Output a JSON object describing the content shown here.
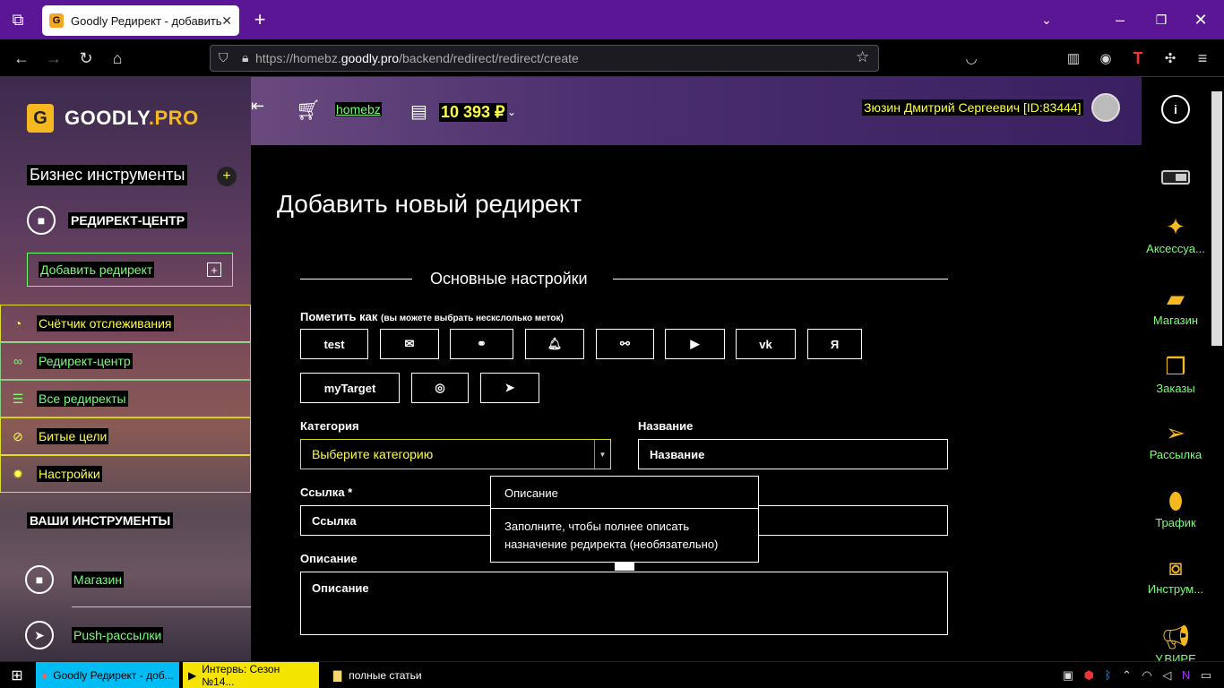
{
  "browser": {
    "tab_title": "Goodly Редирект - добавить",
    "url_prefix": "https://homebz.",
    "url_domain": "goodly.pro",
    "url_path": "/backend/redirect/redirect/create"
  },
  "sidebar": {
    "logo_text_main": "GOODLY",
    "logo_text_suffix": ".PRO",
    "logo_letter": "G",
    "section_title": "Бизнес инструменты",
    "active_tool": "РЕДИРЕКТ-ЦЕНТР",
    "add_button": "Добавить редирект",
    "menu": [
      {
        "label": "Счётчик отслеживания",
        "color": "#ffff44",
        "icon": "gauge-icon",
        "glyph": "◔"
      },
      {
        "label": "Редирект-центр",
        "color": "#77ff77",
        "icon": "link-icon",
        "glyph": "∞"
      },
      {
        "label": "Все редиректы",
        "color": "#77ff77",
        "icon": "list-icon",
        "glyph": "☰"
      },
      {
        "label": "Битые цели",
        "color": "#ffff44",
        "icon": "ban-icon",
        "glyph": "⊘"
      },
      {
        "label": "Настройки",
        "color": "#ffff44",
        "icon": "gear-icon",
        "glyph": "✹"
      }
    ],
    "tools_title": "ВАШИ ИНСТРУМЕНТЫ",
    "tools": [
      {
        "label": "Магазин"
      },
      {
        "label": "Push-рассылки"
      }
    ]
  },
  "header": {
    "shop_link": "homebz",
    "balance": "10 393 ₽",
    "user": "Зюзин Дмитрий Сергеевич [ID:83444]"
  },
  "page": {
    "title": "Добавить новый редирект",
    "section": "Основные настройки",
    "mark_label": "Пометить как",
    "mark_hint": "(вы можете выбрать нескслолько меток)",
    "marks_row1": [
      "test",
      "",
      "",
      "",
      "",
      "",
      "",
      "Я"
    ],
    "marks_row2": [
      "myTarget",
      "",
      ""
    ],
    "category_label": "Категория",
    "category_value": "Выберите категорию",
    "name_label": "Название",
    "name_placeholder": "Название",
    "link_label": "Ссылка *",
    "link_placeholder": "Ссылка",
    "desc_label": "Описание",
    "desc_placeholder": "Описание",
    "tooltip_title": "Описание",
    "tooltip_body": "Заполните, чтобы полнее описать назначение редиректа (необязательно)"
  },
  "rightbar": {
    "items": [
      {
        "label": "Аксессуа...",
        "icon": "accessories-icon"
      },
      {
        "label": "Магазин",
        "icon": "shop-bag-icon"
      },
      {
        "label": "Заказы",
        "icon": "orders-icon"
      },
      {
        "label": "Рассылка",
        "icon": "mail-plane-icon"
      },
      {
        "label": "Трафик",
        "icon": "mouse-icon"
      },
      {
        "label": "Инструм...",
        "icon": "toolbox-icon"
      },
      {
        "label": "У.ВИРЕ",
        "icon": "megaphone-icon"
      }
    ]
  },
  "taskbar": {
    "items": [
      {
        "label": "Goodly Редирект - доб...",
        "color": "#00bcf2"
      },
      {
        "label": "Интервь: Сезон №14...",
        "color": "#f5e400"
      },
      {
        "label": "полные статьи",
        "color": "#000000"
      }
    ]
  }
}
